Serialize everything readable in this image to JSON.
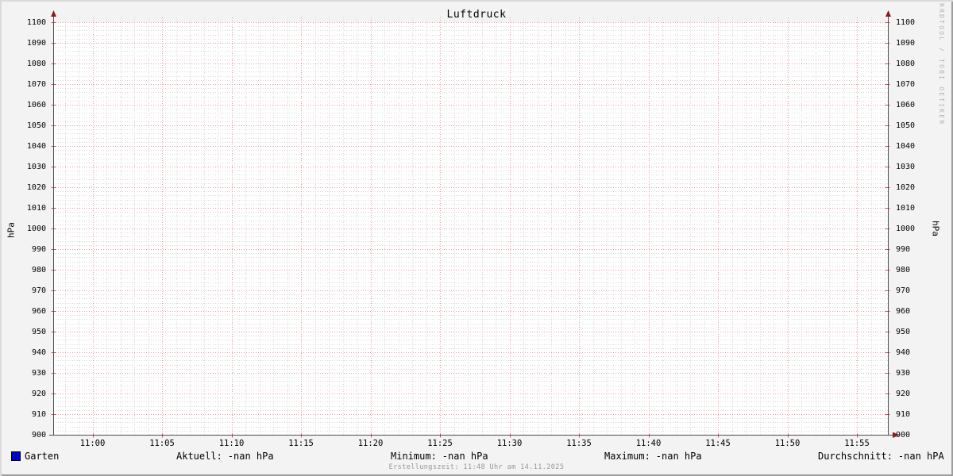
{
  "title": "Luftdruck",
  "watermark": "RRDTOOL / TOBI OETIKER",
  "footer_note": "Erstellungszeit: 11:48 Uhr am 14.11.2025",
  "y_axis": {
    "left_label": "hPa",
    "right_label": "hPa"
  },
  "legend": {
    "series_label": "Garten",
    "series_color": "#0000cc",
    "stats": [
      {
        "label": "Aktuell:",
        "value": "-nan hPa"
      },
      {
        "label": "Minimum:",
        "value": "-nan hPa"
      },
      {
        "label": "Maximum:",
        "value": "-nan hPa"
      },
      {
        "label": "Durchschnitt:",
        "value": "-nan hPA"
      }
    ]
  },
  "chart_data": {
    "type": "line",
    "title": "Luftdruck",
    "xlabel": "",
    "ylabel": "hPa",
    "ylim": [
      900,
      1100
    ],
    "y_major_step": 10,
    "y_minor_step": 2,
    "x_tick_labels": [
      "11:00",
      "11:05",
      "11:10",
      "11:15",
      "11:20",
      "11:25",
      "11:30",
      "11:35",
      "11:40",
      "11:45",
      "11:50",
      "11:55"
    ],
    "x_minor_ticks_per_major": 5,
    "grid": {
      "major_color": "#ee9a9a",
      "minor_color": "#d8d8d8",
      "style": "dotted"
    },
    "axis_color": "#4d4d4d",
    "axis_arrow_color": "#8b1a1a",
    "tick_color": "#cc5555",
    "plot_background": "#ffffff",
    "legend_position": "bottom",
    "series": [
      {
        "name": "Garten",
        "color": "#0000cc",
        "values": []
      }
    ]
  }
}
